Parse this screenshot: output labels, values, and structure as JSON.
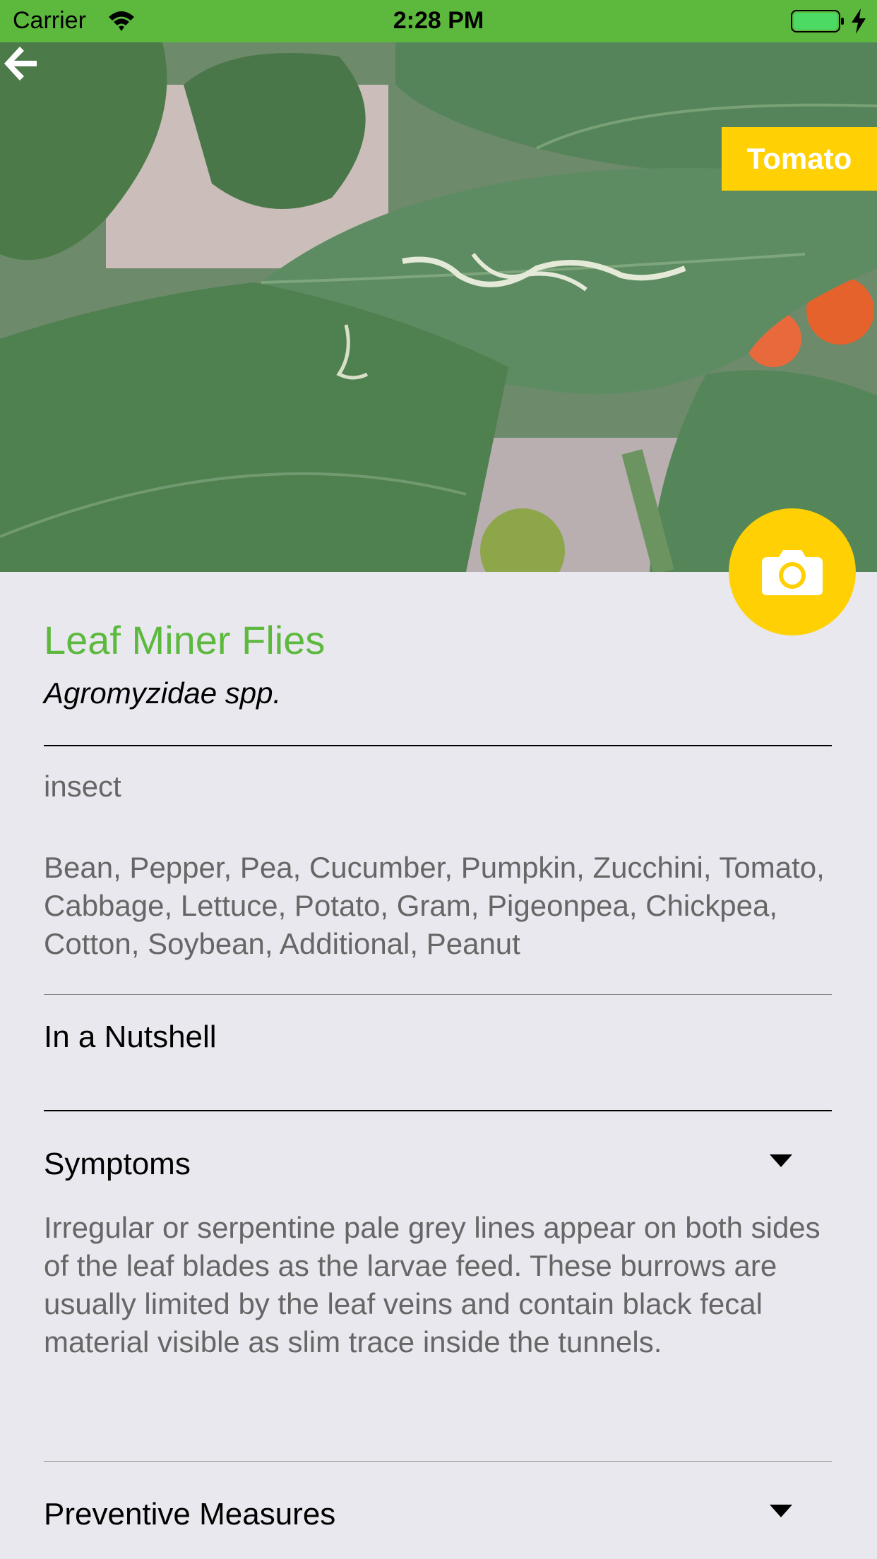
{
  "status_bar": {
    "carrier": "Carrier",
    "time": "2:28 PM",
    "icons": [
      "wifi-icon",
      "battery-icon",
      "charging-bolt-icon"
    ]
  },
  "header": {
    "back_icon": "arrow-left-icon",
    "crop_badge": "Tomato",
    "camera_icon": "camera-icon",
    "accent_color": "#ffd104"
  },
  "pest": {
    "common_name": "Leaf Miner Flies",
    "scientific_name": "Agromyzidae spp.",
    "category": "insect",
    "host_crops": "Bean, Pepper, Pea, Cucumber, Pumpkin, Zucchini, Tomato, Cabbage, Lettuce, Potato, Gram, Pigeonpea, Chickpea, Cotton, Soybean, Additional, Peanut",
    "title_color": "#5cb93e"
  },
  "sections": {
    "nutshell_label": "In a Nutshell",
    "symptoms_label": "Symptoms",
    "symptoms_text": "Irregular or serpentine pale grey lines appear on both sides of the leaf blades as the larvae feed. These burrows are usually limited by the leaf veins and contain black fecal material visible as slim trace inside the tunnels.",
    "preventive_label": "Preventive Measures",
    "expand_icon": "chevron-down-icon"
  }
}
